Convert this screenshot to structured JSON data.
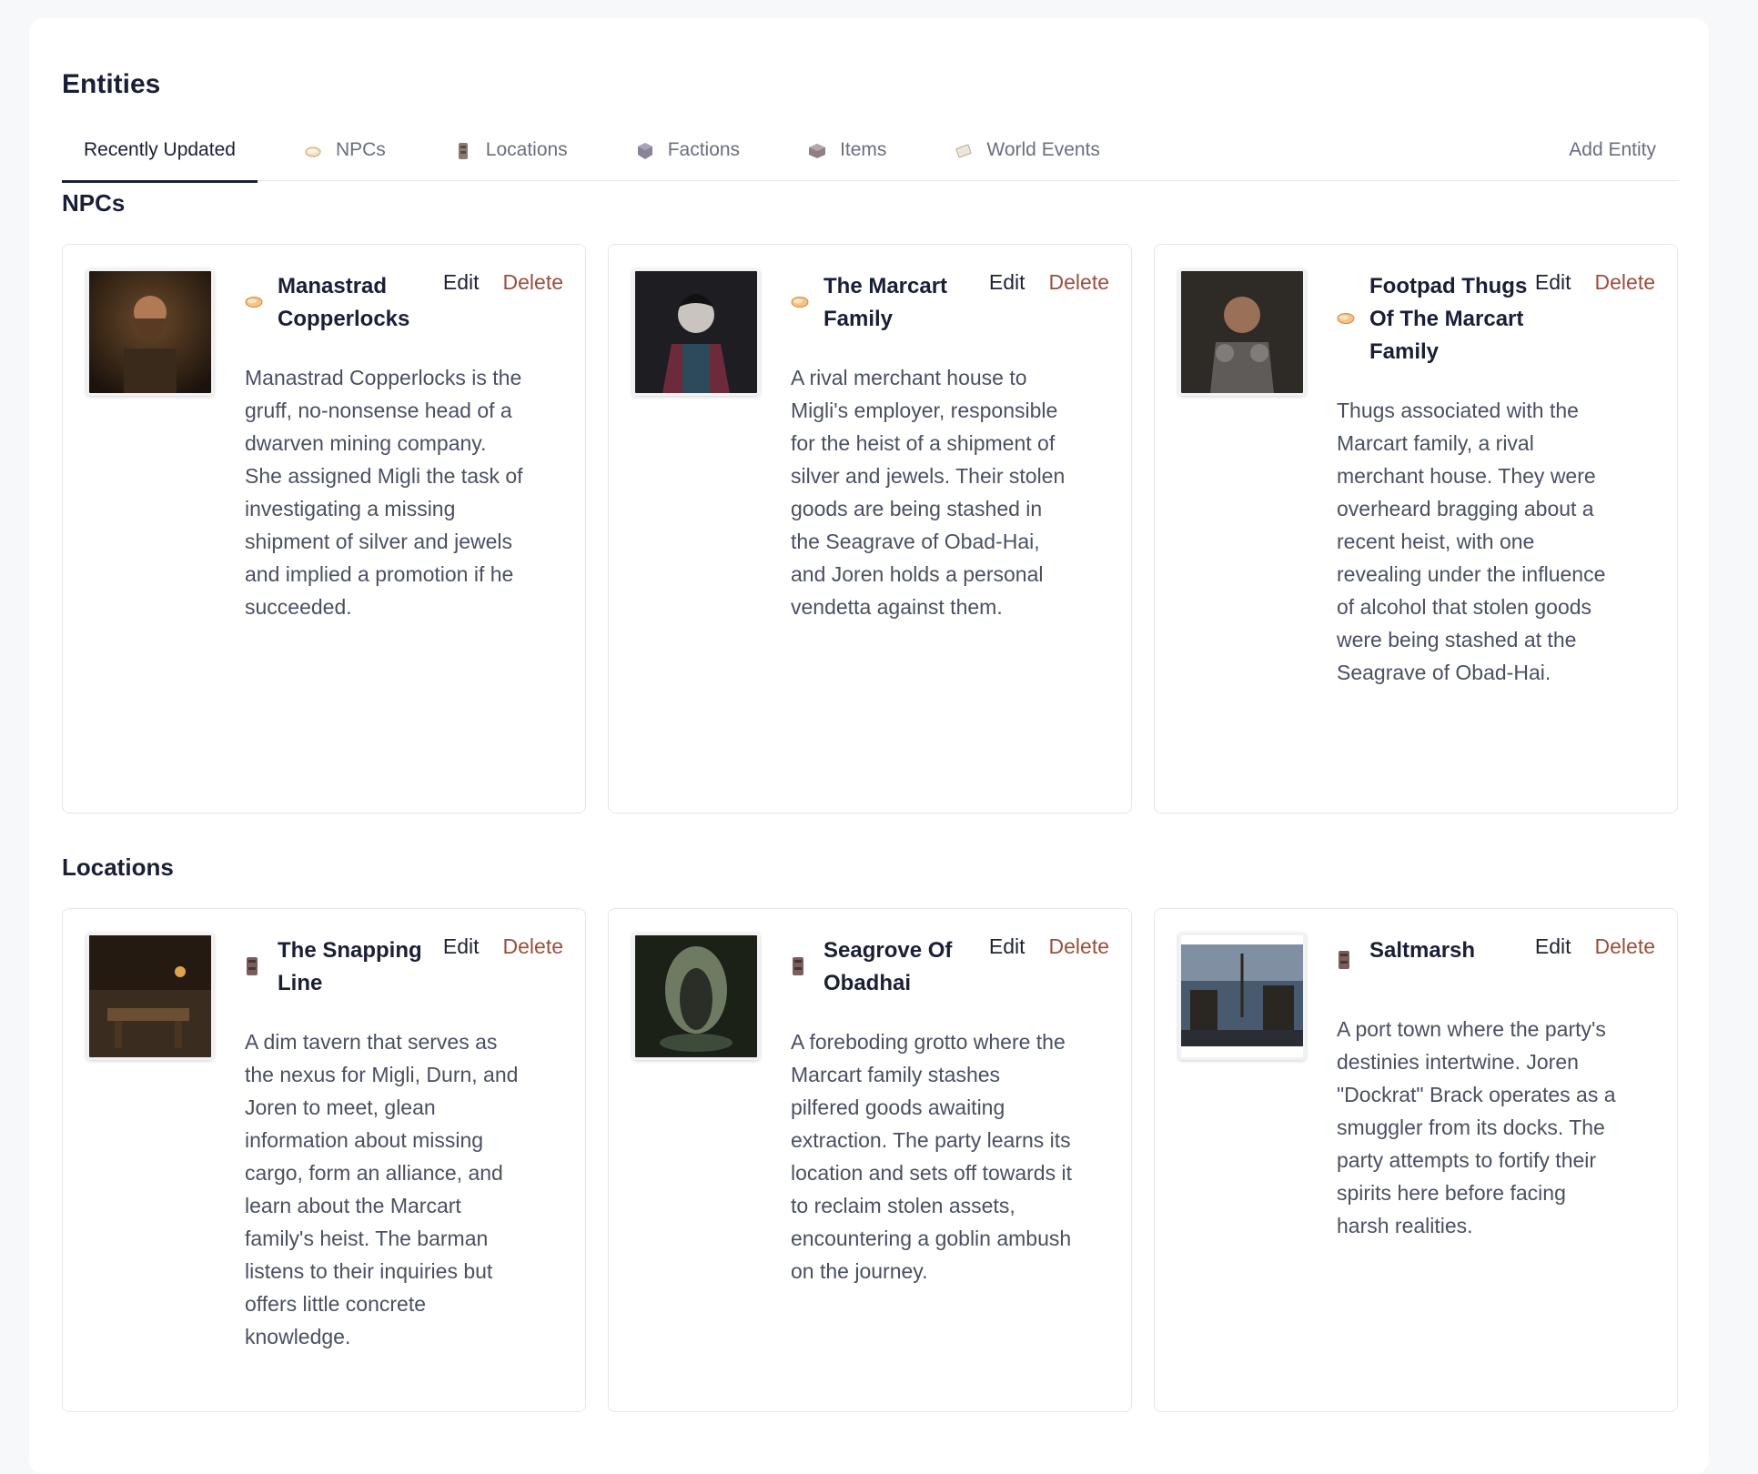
{
  "page": {
    "title": "Entities"
  },
  "tabs": [
    {
      "label": "Recently Updated",
      "icon": "",
      "active": true
    },
    {
      "label": "NPCs",
      "icon": "npc-icon"
    },
    {
      "label": "Locations",
      "icon": "location-icon"
    },
    {
      "label": "Factions",
      "icon": "faction-icon"
    },
    {
      "label": "Items",
      "icon": "item-icon"
    },
    {
      "label": "World Events",
      "icon": "world-event-icon"
    }
  ],
  "add_entity_label": "Add Entity",
  "actions": {
    "edit": "Edit",
    "delete": "Delete"
  },
  "colors": {
    "delete": "#9b4f3d",
    "active_tab": "#1a1f36",
    "border": "#e4e6ec"
  },
  "sections": [
    {
      "title": "NPCs",
      "type_icon": "npc-icon",
      "cards": [
        {
          "name": "Manastrad Copperlocks",
          "portrait": "bearded-dwarf-portrait",
          "description": "Manastrad Copperlocks is the gruff, no-nonsense head of a dwarven mining company. She assigned Migli the task of investigating a missing shipment of silver and jewels and implied a promotion if he succeeded."
        },
        {
          "name": "The Marcart Family",
          "portrait": "pale-noble-portrait",
          "description": "A rival merchant house to Migli's employer, responsible for the heist of a shipment of silver and jewels. Their stolen goods are being stashed in the Seagrave of Obad-Hai, and Joren holds a personal vendetta against them."
        },
        {
          "name": "Footpad Thugs Of The Marcart Family",
          "portrait": "armored-thug-portrait",
          "description": "Thugs associated with the Marcart family, a rival merchant house. They were overheard bragging about a recent heist, with one revealing under the influence of alcohol that stolen goods were being stashed at the Seagrave of Obad-Hai."
        }
      ]
    },
    {
      "title": "Locations",
      "type_icon": "location-icon",
      "cards": [
        {
          "name": "The Snapping Line",
          "portrait": "tavern-interior-image",
          "description": "A dim tavern that serves as the nexus for Migli, Durn, and Joren to meet, glean information about missing cargo, form an alliance, and learn about the Marcart family's heist. The barman listens to their inquiries but offers little concrete knowledge."
        },
        {
          "name": "Seagrove Of Obadhai",
          "portrait": "grotto-cave-image",
          "description": "A foreboding grotto where the Marcart family stashes pilfered goods awaiting extraction. The party learns its location and sets off towards it to reclaim stolen assets, encountering a goblin ambush on the journey."
        },
        {
          "name": "Saltmarsh",
          "portrait": "port-town-image",
          "description": "A port town where the party's destinies intertwine. Joren \"Dockrat\" Brack operates as a smuggler from its docks. The party attempts to fortify their spirits here before facing harsh realities."
        }
      ]
    }
  ]
}
